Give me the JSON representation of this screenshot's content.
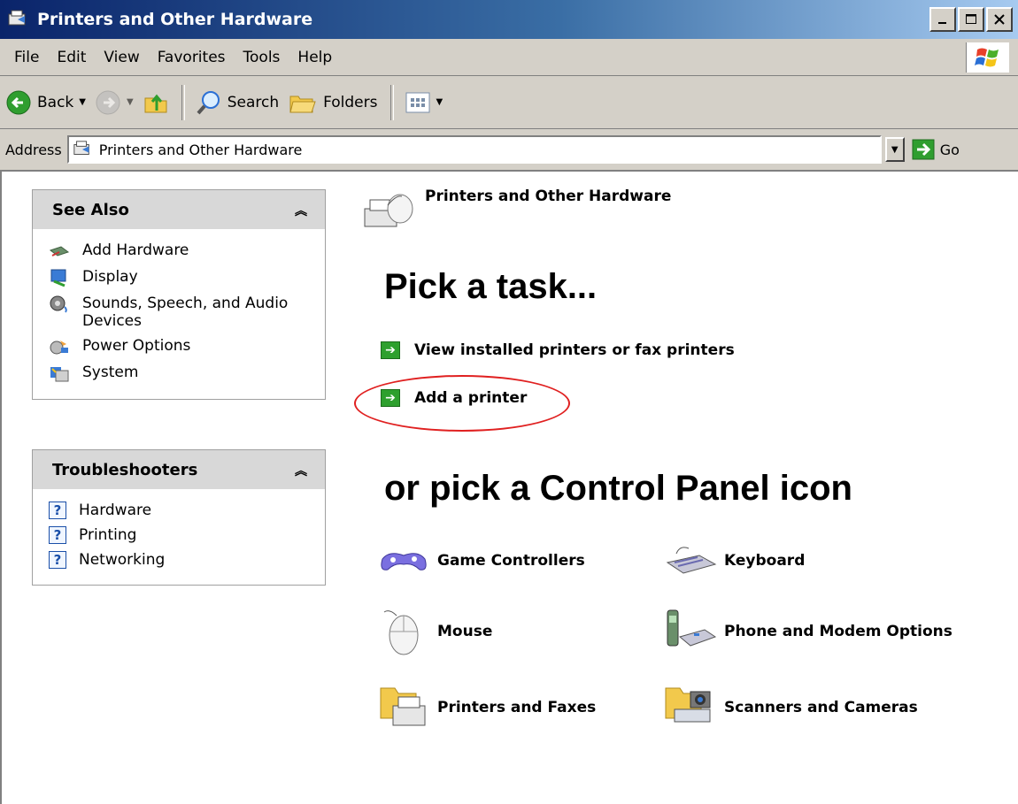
{
  "window": {
    "title": "Printers and Other Hardware"
  },
  "menu": {
    "items": [
      "File",
      "Edit",
      "View",
      "Favorites",
      "Tools",
      "Help"
    ]
  },
  "toolbar": {
    "back": "Back",
    "search": "Search",
    "folders": "Folders"
  },
  "address": {
    "label": "Address",
    "value": "Printers and Other Hardware",
    "go": "Go"
  },
  "see_also": {
    "title": "See Also",
    "items": [
      {
        "label": "Add Hardware",
        "icon": "add-hardware-icon"
      },
      {
        "label": "Display",
        "icon": "display-icon"
      },
      {
        "label": "Sounds, Speech, and Audio Devices",
        "icon": "sounds-icon"
      },
      {
        "label": "Power Options",
        "icon": "power-options-icon"
      },
      {
        "label": "System",
        "icon": "system-icon"
      }
    ]
  },
  "troubleshooters": {
    "title": "Troubleshooters",
    "items": [
      {
        "label": "Hardware",
        "icon": "help-icon"
      },
      {
        "label": "Printing",
        "icon": "help-icon"
      },
      {
        "label": "Networking",
        "icon": "help-icon"
      }
    ]
  },
  "content": {
    "category_title": "Printers and Other Hardware",
    "pick_task": "Pick a task...",
    "tasks": [
      "View installed printers or fax printers",
      "Add a printer"
    ],
    "pick_icon": "or pick a Control Panel icon",
    "icons": [
      {
        "label": "Game Controllers",
        "icon": "game-controller-icon"
      },
      {
        "label": "Keyboard",
        "icon": "keyboard-icon"
      },
      {
        "label": "Mouse",
        "icon": "mouse-icon"
      },
      {
        "label": "Phone and Modem Options",
        "icon": "phone-modem-icon"
      },
      {
        "label": "Printers and Faxes",
        "icon": "printer-fax-icon"
      },
      {
        "label": "Scanners and Cameras",
        "icon": "scanner-camera-icon"
      }
    ]
  },
  "annotation": {
    "highlight_color": "#e02020"
  }
}
